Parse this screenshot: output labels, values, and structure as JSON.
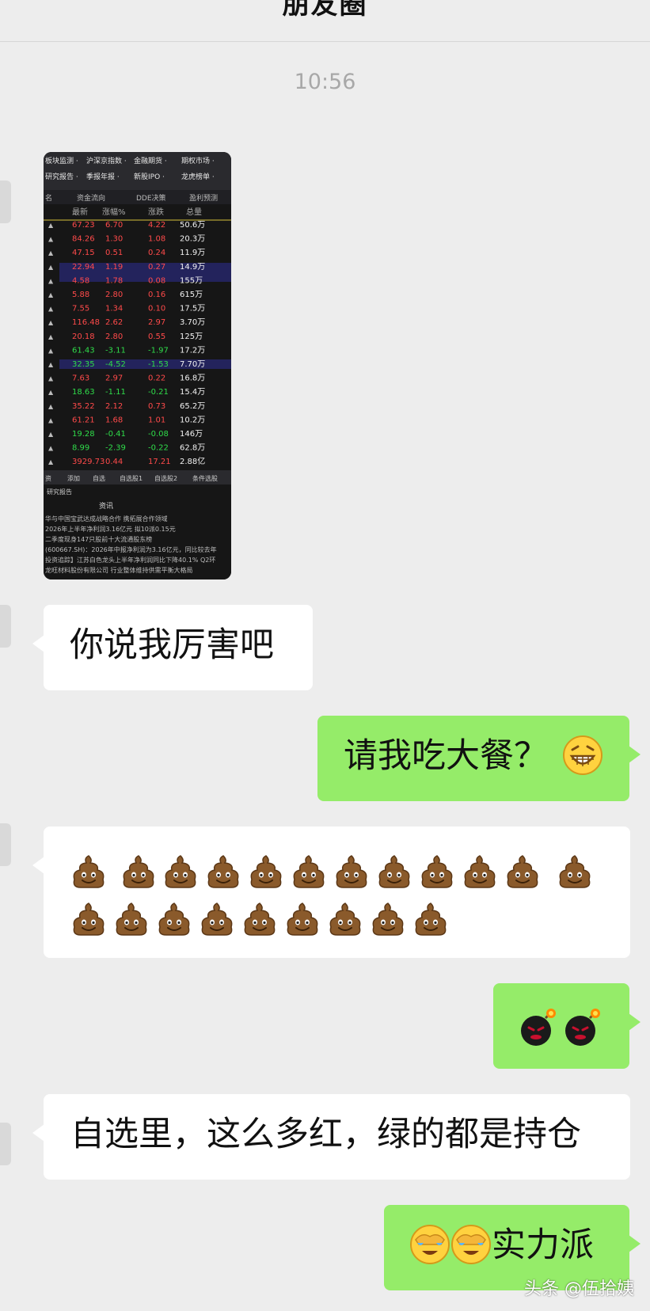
{
  "header": {
    "title": "朋友圈"
  },
  "chat": {
    "timestamp": "10:56",
    "messages": [
      {
        "sender": "other",
        "type": "image",
        "content": "stock app screenshot"
      },
      {
        "sender": "other",
        "type": "text",
        "text": "你说我厉害吧"
      },
      {
        "sender": "self",
        "type": "text",
        "text": "请我吃大餐？",
        "emoji": "grin-emoji"
      },
      {
        "sender": "other",
        "type": "emoji",
        "emoji": "poo-emoji",
        "count": 21
      },
      {
        "sender": "self",
        "type": "emoji",
        "emoji": "bomb-emoji",
        "count": 2
      },
      {
        "sender": "other",
        "type": "text",
        "text": "自选里，这么多红，绿的都是持仓"
      },
      {
        "sender": "self",
        "type": "text",
        "text": "实力派",
        "emoji": "facepalm-emoji",
        "emoji_count": 2
      }
    ]
  },
  "stock_image": {
    "menu_row1": [
      "板块监测 ·",
      "沪深京指数 ·",
      "金融期货 ·",
      "期权市场 ·"
    ],
    "menu_row2": [
      "研究报告 ·",
      "季报年报 ·",
      "新股IPO ·",
      "龙虎榜单 ·"
    ],
    "tabs": [
      "名",
      "资金流向",
      "DDE决策",
      "盈利预测"
    ],
    "columns": [
      "最新",
      "涨幅%",
      "涨跌",
      "总量"
    ],
    "rows": [
      [
        "67.23",
        "6.70",
        "4.22",
        "50.6万"
      ],
      [
        "84.26",
        "1.30",
        "1.08",
        "20.3万"
      ],
      [
        "47.15",
        "0.51",
        "0.24",
        "11.9万"
      ],
      [
        "22.94",
        "1.19",
        "0.27",
        "14.9万"
      ],
      [
        "4.58",
        "1.78",
        "0.08",
        "155万"
      ],
      [
        "5.88",
        "2.80",
        "0.16",
        "615万"
      ],
      [
        "7.55",
        "1.34",
        "0.10",
        "17.5万"
      ],
      [
        "116.48",
        "2.62",
        "2.97",
        "3.70万"
      ],
      [
        "20.18",
        "2.80",
        "0.55",
        "125万"
      ],
      [
        "61.43",
        "-3.11",
        "-1.97",
        "17.2万"
      ],
      [
        "32.35",
        "-4.52",
        "-1.53",
        "7.70万"
      ],
      [
        "7.63",
        "2.97",
        "0.22",
        "16.8万"
      ],
      [
        "18.63",
        "-1.11",
        "-0.21",
        "15.4万"
      ],
      [
        "35.22",
        "2.12",
        "0.73",
        "65.2万"
      ],
      [
        "61.21",
        "1.68",
        "1.01",
        "10.2万"
      ],
      [
        "19.28",
        "-0.41",
        "-0.08",
        "146万"
      ],
      [
        "8.99",
        "-2.39",
        "-0.22",
        "62.8万"
      ],
      [
        "3929.73",
        "0.44",
        "17.21",
        "2.88亿"
      ]
    ],
    "bottom_tabs": [
      "资",
      "添加",
      "自选",
      "自选股1",
      "自选股2",
      "条件选股"
    ],
    "sub_tab": "研究报告",
    "news_title": "资讯",
    "news": [
      "华与中国宝武达成战略合作 携拓展合作领域",
      "2026年上半年净利润3.16亿元 拟10派0.15元",
      "二季度现身147只股前十大流通股东榜",
      "(600667.SH)：2026年中报净利润为3.16亿元，同比较去年",
      "投资追踪】江苏白色龙头上半年净利润同比下降40.1% Q2环",
      "龙旺材料股份有限公司 行业整体维持供需平衡大格局"
    ]
  },
  "watermark": {
    "text": "头条 @伍拾姨"
  },
  "colors": {
    "background": "#ededed",
    "self_bubble": "#95ec69",
    "other_bubble": "#ffffff",
    "stock_up": "#ff4a4a",
    "stock_down": "#2fdc4a"
  }
}
